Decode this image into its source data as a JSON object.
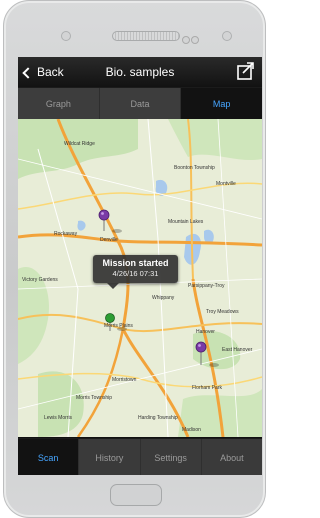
{
  "nav": {
    "back_label": "Back",
    "title": "Bio. samples"
  },
  "tabs": [
    "Graph",
    "Data",
    "Map"
  ],
  "active_tab": "Map",
  "callout": {
    "title": "Mission started",
    "timestamp": "4/26/16 07:31"
  },
  "bottom_tabs": [
    "Scan",
    "History",
    "Settings",
    "About"
  ],
  "active_bottom_tab": "Scan",
  "colors": {
    "accent": "#46a5ff",
    "pin_green": "#2c9d33",
    "pin_purple": "#7a3aa6"
  },
  "map_labels": [
    "Wildcat Ridge",
    "Boonton Township",
    "Mountain Lakes",
    "Rockaway",
    "Victory Gardens",
    "Denville",
    "Parsippany-Troy",
    "Morris Plains",
    "Hanover",
    "East Hanover",
    "Morristown",
    "Florham Park",
    "Madison",
    "Lewis Morris",
    "Harding Township",
    "Morris Township",
    "Troy Meadows",
    "Whippany",
    "Montville"
  ]
}
